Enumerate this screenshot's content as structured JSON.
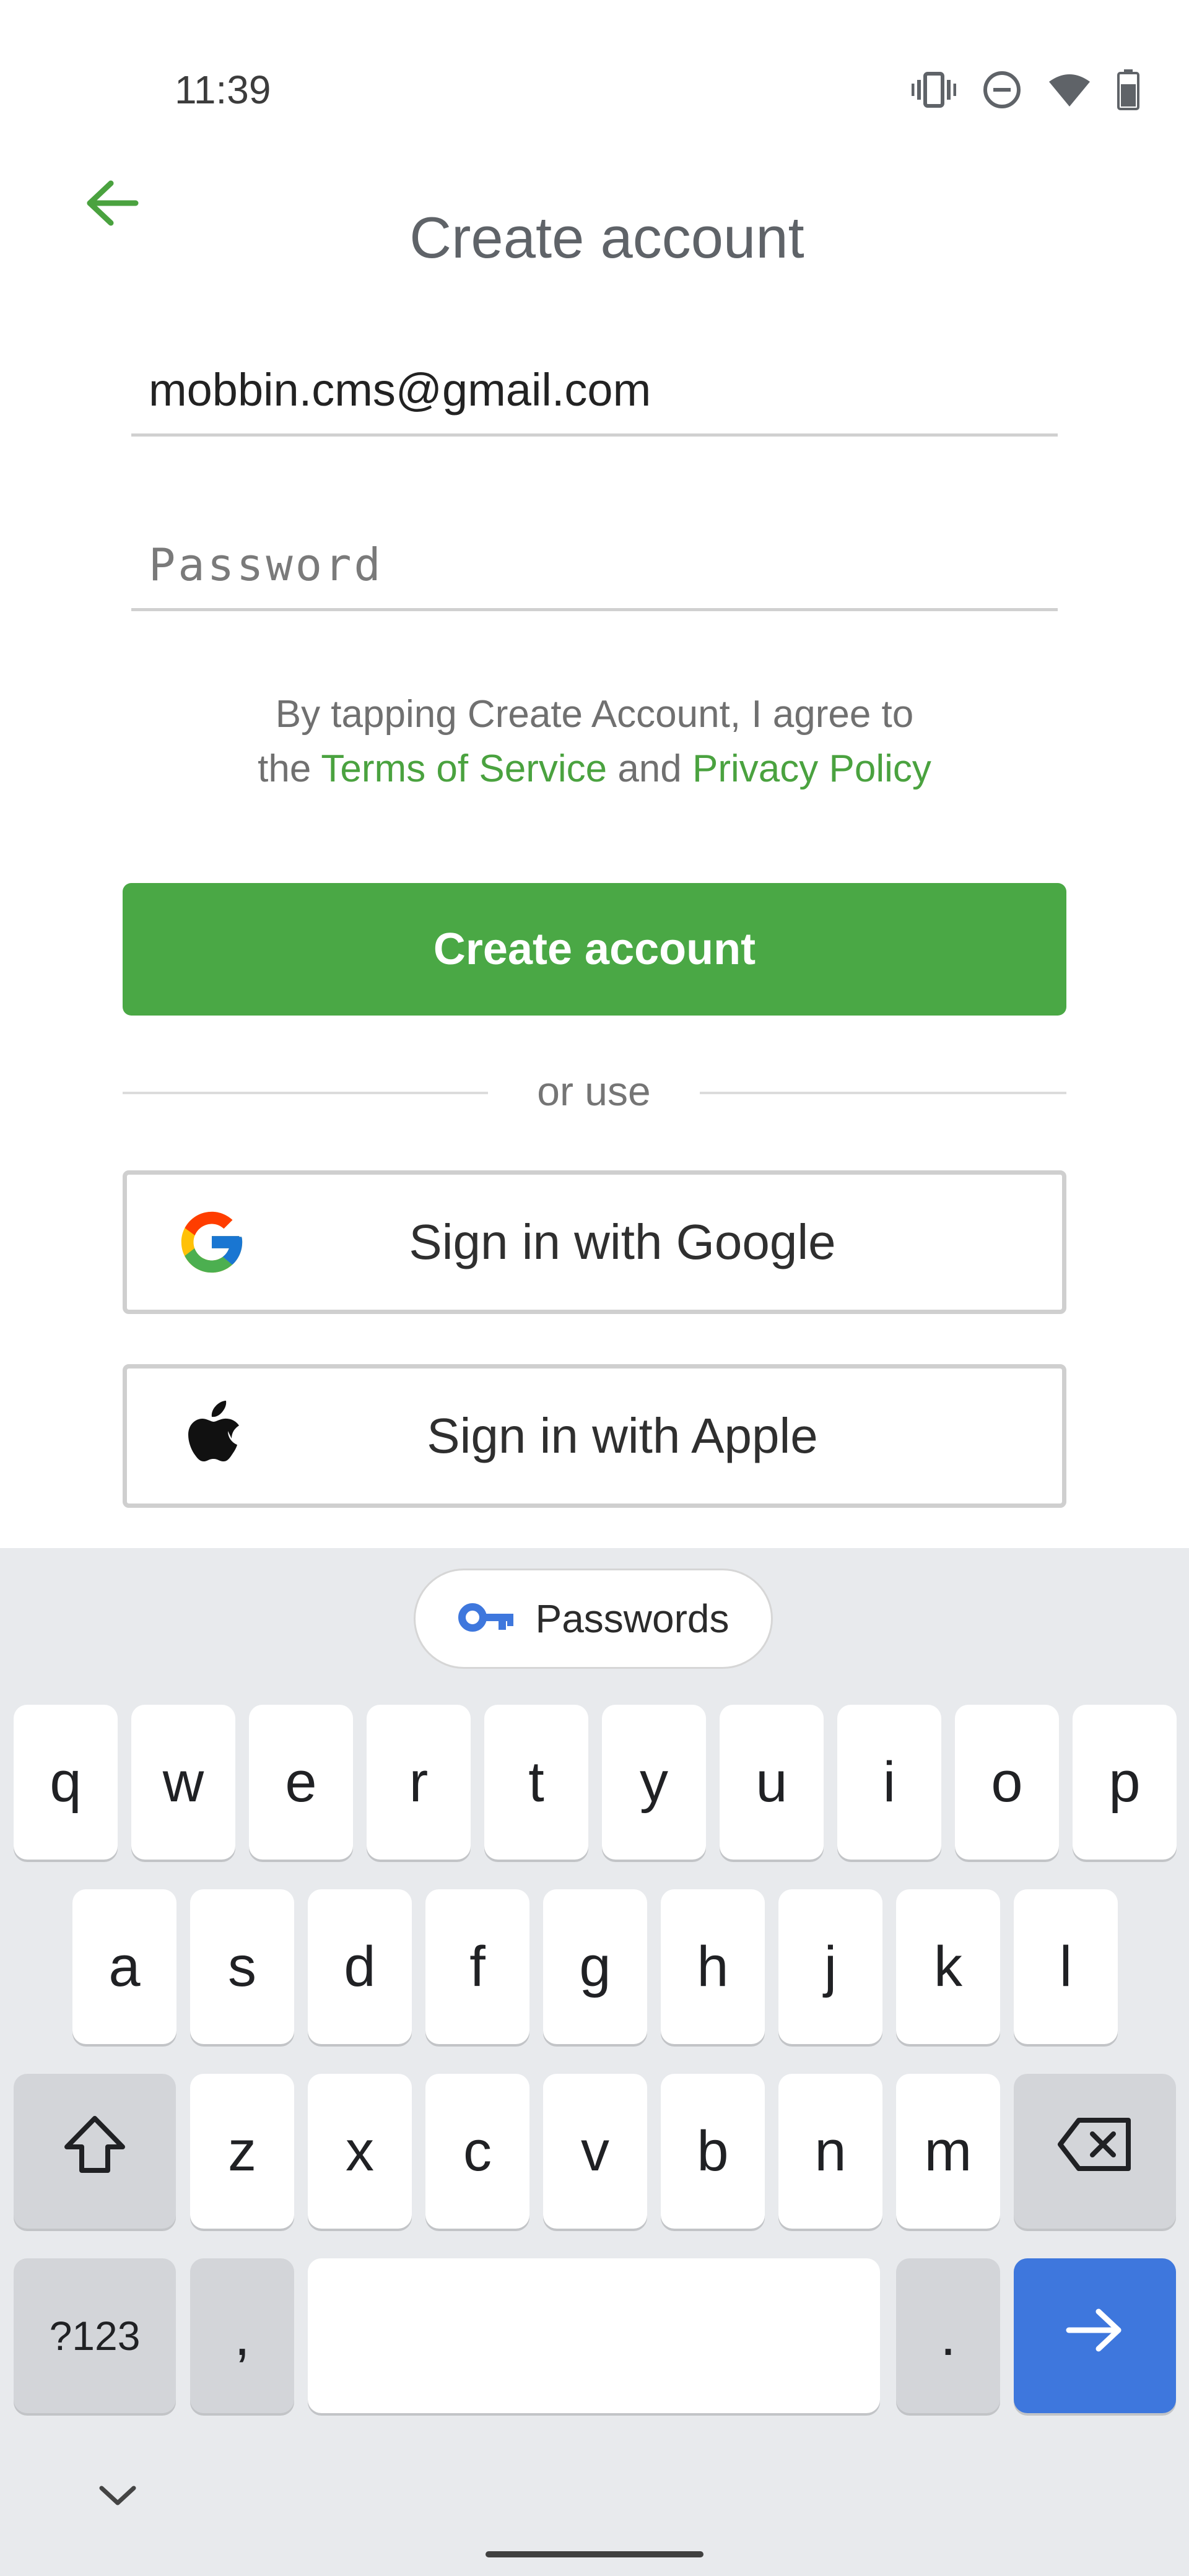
{
  "status_bar": {
    "time": "11:39",
    "icons": [
      "vibrate-icon",
      "do-not-disturb-icon",
      "wifi-icon",
      "battery-icon"
    ]
  },
  "header": {
    "back_icon": "arrow-left-icon",
    "title": "Create account"
  },
  "form": {
    "email_value": "mobbin.cms@gmail.com",
    "password_placeholder": "Password"
  },
  "terms": {
    "line1": "By tapping Create Account, I agree to",
    "prefix": "the",
    "terms_link": "Terms of Service",
    "conjunction": "and",
    "privacy_link": "Privacy Policy"
  },
  "create_button_label": "Create account",
  "divider_text": "or use",
  "social": {
    "google_label": "Sign in with Google",
    "apple_label": "Sign in with Apple"
  },
  "keyboard": {
    "suggestion_label": "Passwords",
    "row1": [
      "q",
      "w",
      "e",
      "r",
      "t",
      "y",
      "u",
      "i",
      "o",
      "p"
    ],
    "row2": [
      "a",
      "s",
      "d",
      "f",
      "g",
      "h",
      "j",
      "k",
      "l"
    ],
    "row3": [
      "z",
      "x",
      "c",
      "v",
      "b",
      "n",
      "m"
    ],
    "symbols_label": "?123",
    "comma_label": ",",
    "period_label": "."
  },
  "colors": {
    "brand_green": "#4aa845",
    "link_green": "#4aa23f",
    "keyboard_action_blue": "#3e77dd",
    "keyboard_background": "#e8eaed"
  }
}
